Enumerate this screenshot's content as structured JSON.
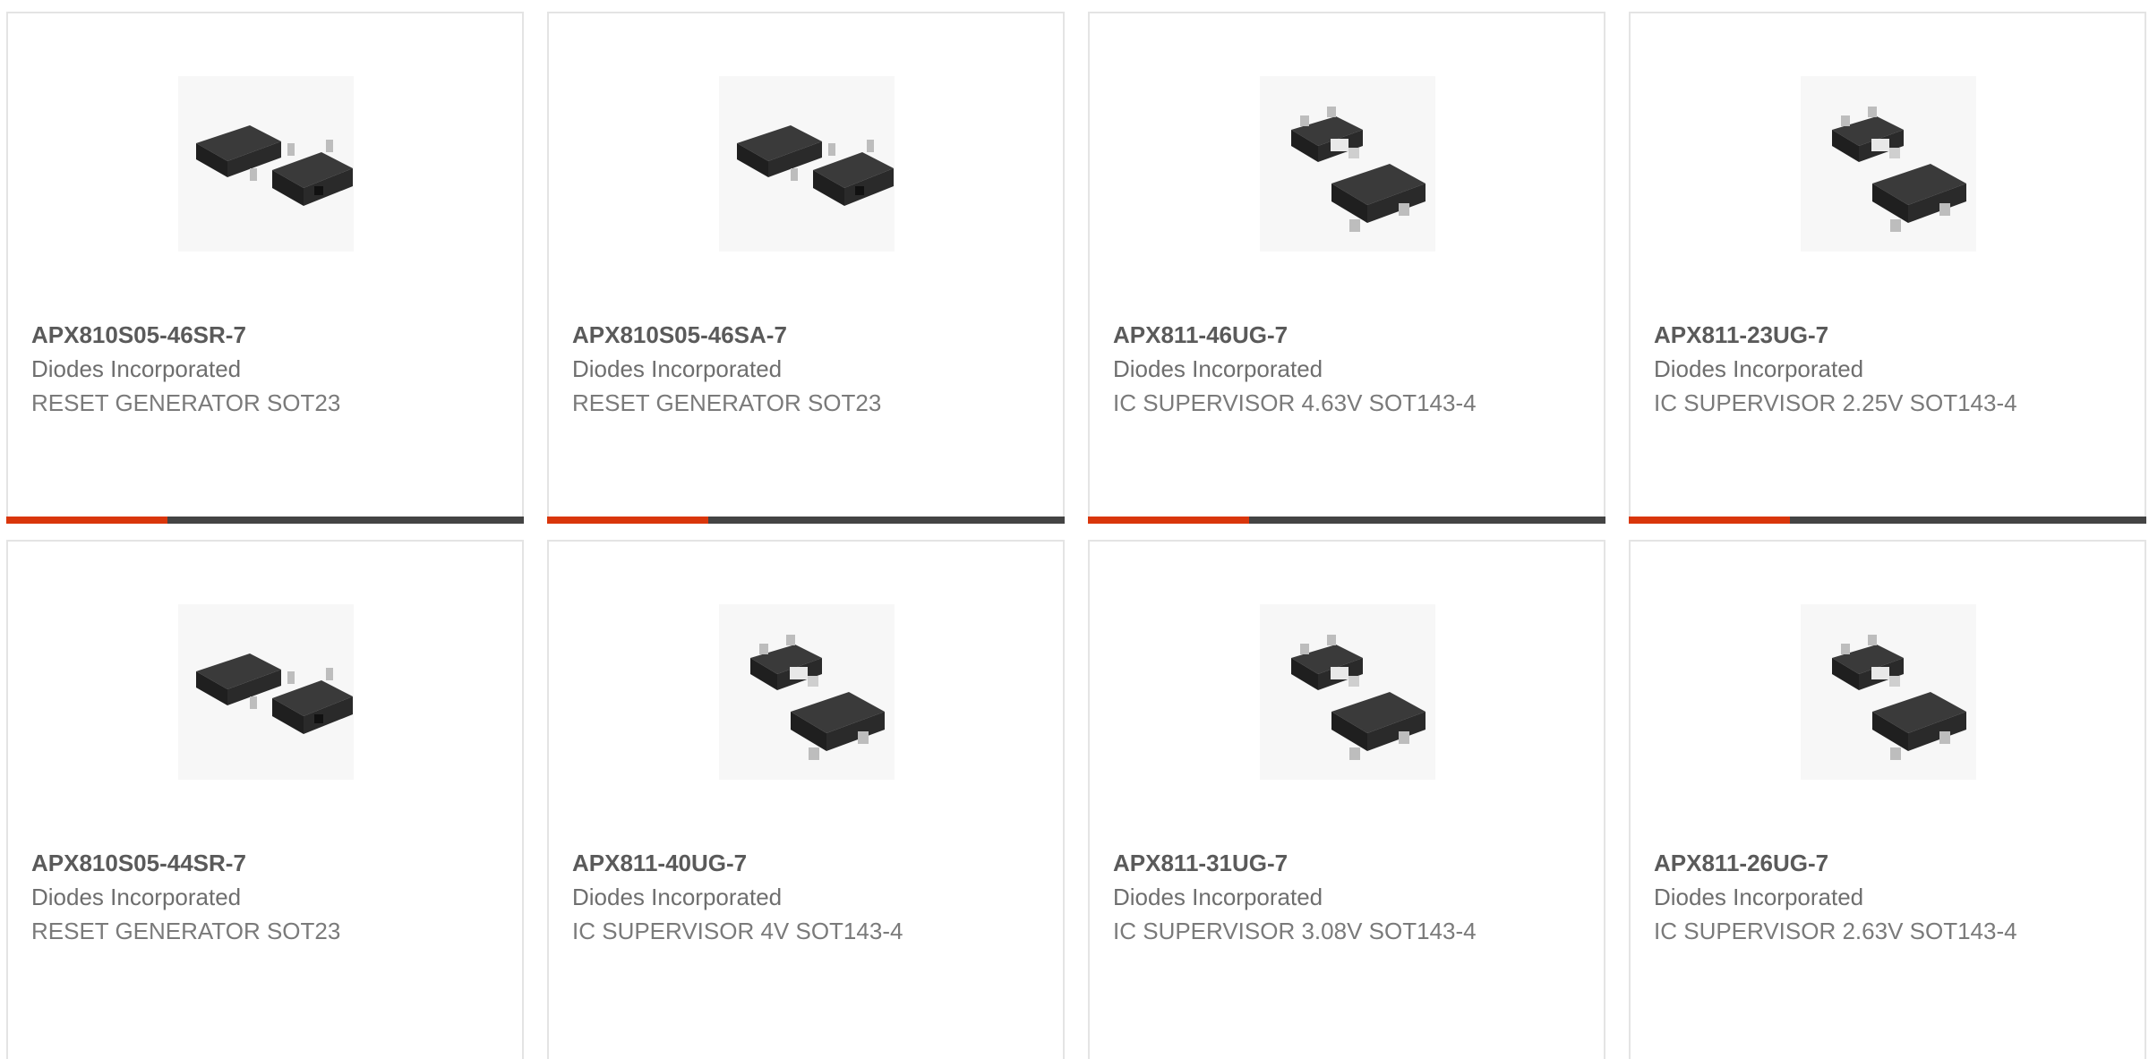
{
  "products": [
    {
      "part": "APX810S05-46SR-7",
      "manufacturer": "Diodes Incorporated",
      "description": "RESET GENERATOR SOT23",
      "image": "sot23-package-image"
    },
    {
      "part": "APX810S05-46SA-7",
      "manufacturer": "Diodes Incorporated",
      "description": "RESET GENERATOR SOT23",
      "image": "sot23-package-image"
    },
    {
      "part": "APX811-46UG-7",
      "manufacturer": "Diodes Incorporated",
      "description": "IC SUPERVISOR 4.63V SOT143-4",
      "image": "sot143-package-image"
    },
    {
      "part": "APX811-23UG-7",
      "manufacturer": "Diodes Incorporated",
      "description": "IC SUPERVISOR 2.25V SOT143-4",
      "image": "sot143-package-image"
    },
    {
      "part": "APX810S05-44SR-7",
      "manufacturer": "Diodes Incorporated",
      "description": "RESET GENERATOR SOT23",
      "image": "sot23-package-image"
    },
    {
      "part": "APX811-40UG-7",
      "manufacturer": "Diodes Incorporated",
      "description": "IC SUPERVISOR 4V SOT143-4",
      "image": "sot143-package-image"
    },
    {
      "part": "APX811-31UG-7",
      "manufacturer": "Diodes Incorporated",
      "description": "IC SUPERVISOR 3.08V SOT143-4",
      "image": "sot143-package-image"
    },
    {
      "part": "APX811-26UG-7",
      "manufacturer": "Diodes Incorporated",
      "description": "IC SUPERVISOR 2.63V SOT143-4",
      "image": "sot143-package-image"
    }
  ],
  "colors": {
    "accent": "#d9360b",
    "bar_track": "#444444",
    "card_border": "#e4e4e4"
  }
}
